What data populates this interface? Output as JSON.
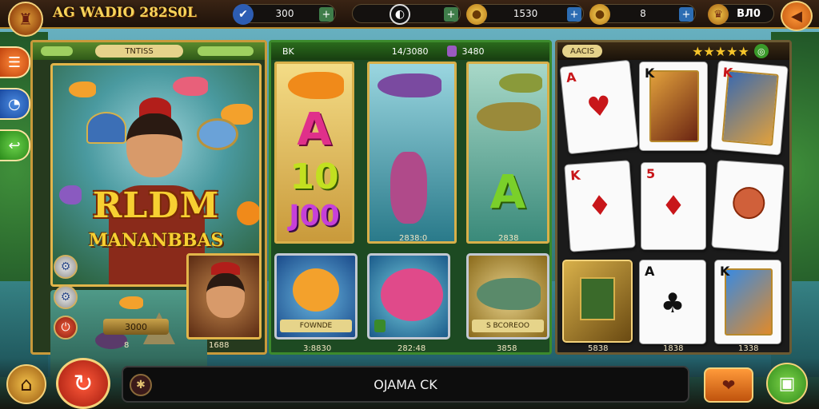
{
  "header": {
    "title": "AG WADIO 282S0L",
    "resources": [
      {
        "icon": "shield-icon",
        "value": "300"
      },
      {
        "icon": "clock-icon",
        "value": ""
      },
      {
        "icon": "coin-icon",
        "value": "1530"
      },
      {
        "icon": "gem-icon",
        "value": "8"
      }
    ],
    "balance": "BЛ0"
  },
  "left_panel": {
    "header_tag": "TNTISS",
    "title": "RLDM",
    "subtitle": "MANANBBAS",
    "pill_value": "3000",
    "left_value": "8",
    "right_value": "1688"
  },
  "middle_panel": {
    "header_left": "BK",
    "header_mid": "14/3080",
    "header_right": "3480",
    "reel_letters": [
      "A",
      "10",
      "J00"
    ],
    "reel_right_letter": "A",
    "reel_footer_left": "2838:0",
    "reel_footer_right": "2838",
    "tiles": [
      {
        "label": "FOWNDE",
        "footer": "3:8830"
      },
      {
        "label": "",
        "footer": "282:48"
      },
      {
        "label": "S BCOREOO",
        "footer": "3858"
      }
    ]
  },
  "right_panel": {
    "header_tag": "AACIS",
    "stars": "★★★★★",
    "cards_row1": [
      {
        "rank": "A",
        "pip": "♥",
        "color": "red"
      },
      {
        "rank": "K",
        "pip": "",
        "color": "black"
      },
      {
        "rank": "K",
        "pip": "",
        "color": "red"
      }
    ],
    "cards_row2": [
      {
        "rank": "K",
        "pip": "♦",
        "color": "red"
      },
      {
        "rank": "5",
        "pip": "♦",
        "color": "red"
      },
      {
        "rank": "",
        "pip": "",
        "color": "red"
      }
    ],
    "cards_row3": [
      {
        "rank": "",
        "pip": "",
        "color": "black"
      },
      {
        "rank": "A",
        "pip": "♣",
        "color": "black"
      },
      {
        "rank": "K",
        "pip": "",
        "color": "black"
      }
    ],
    "footer_values": [
      "5838",
      "1838",
      "1338"
    ]
  },
  "bottom": {
    "message": "OJAMA CK"
  }
}
